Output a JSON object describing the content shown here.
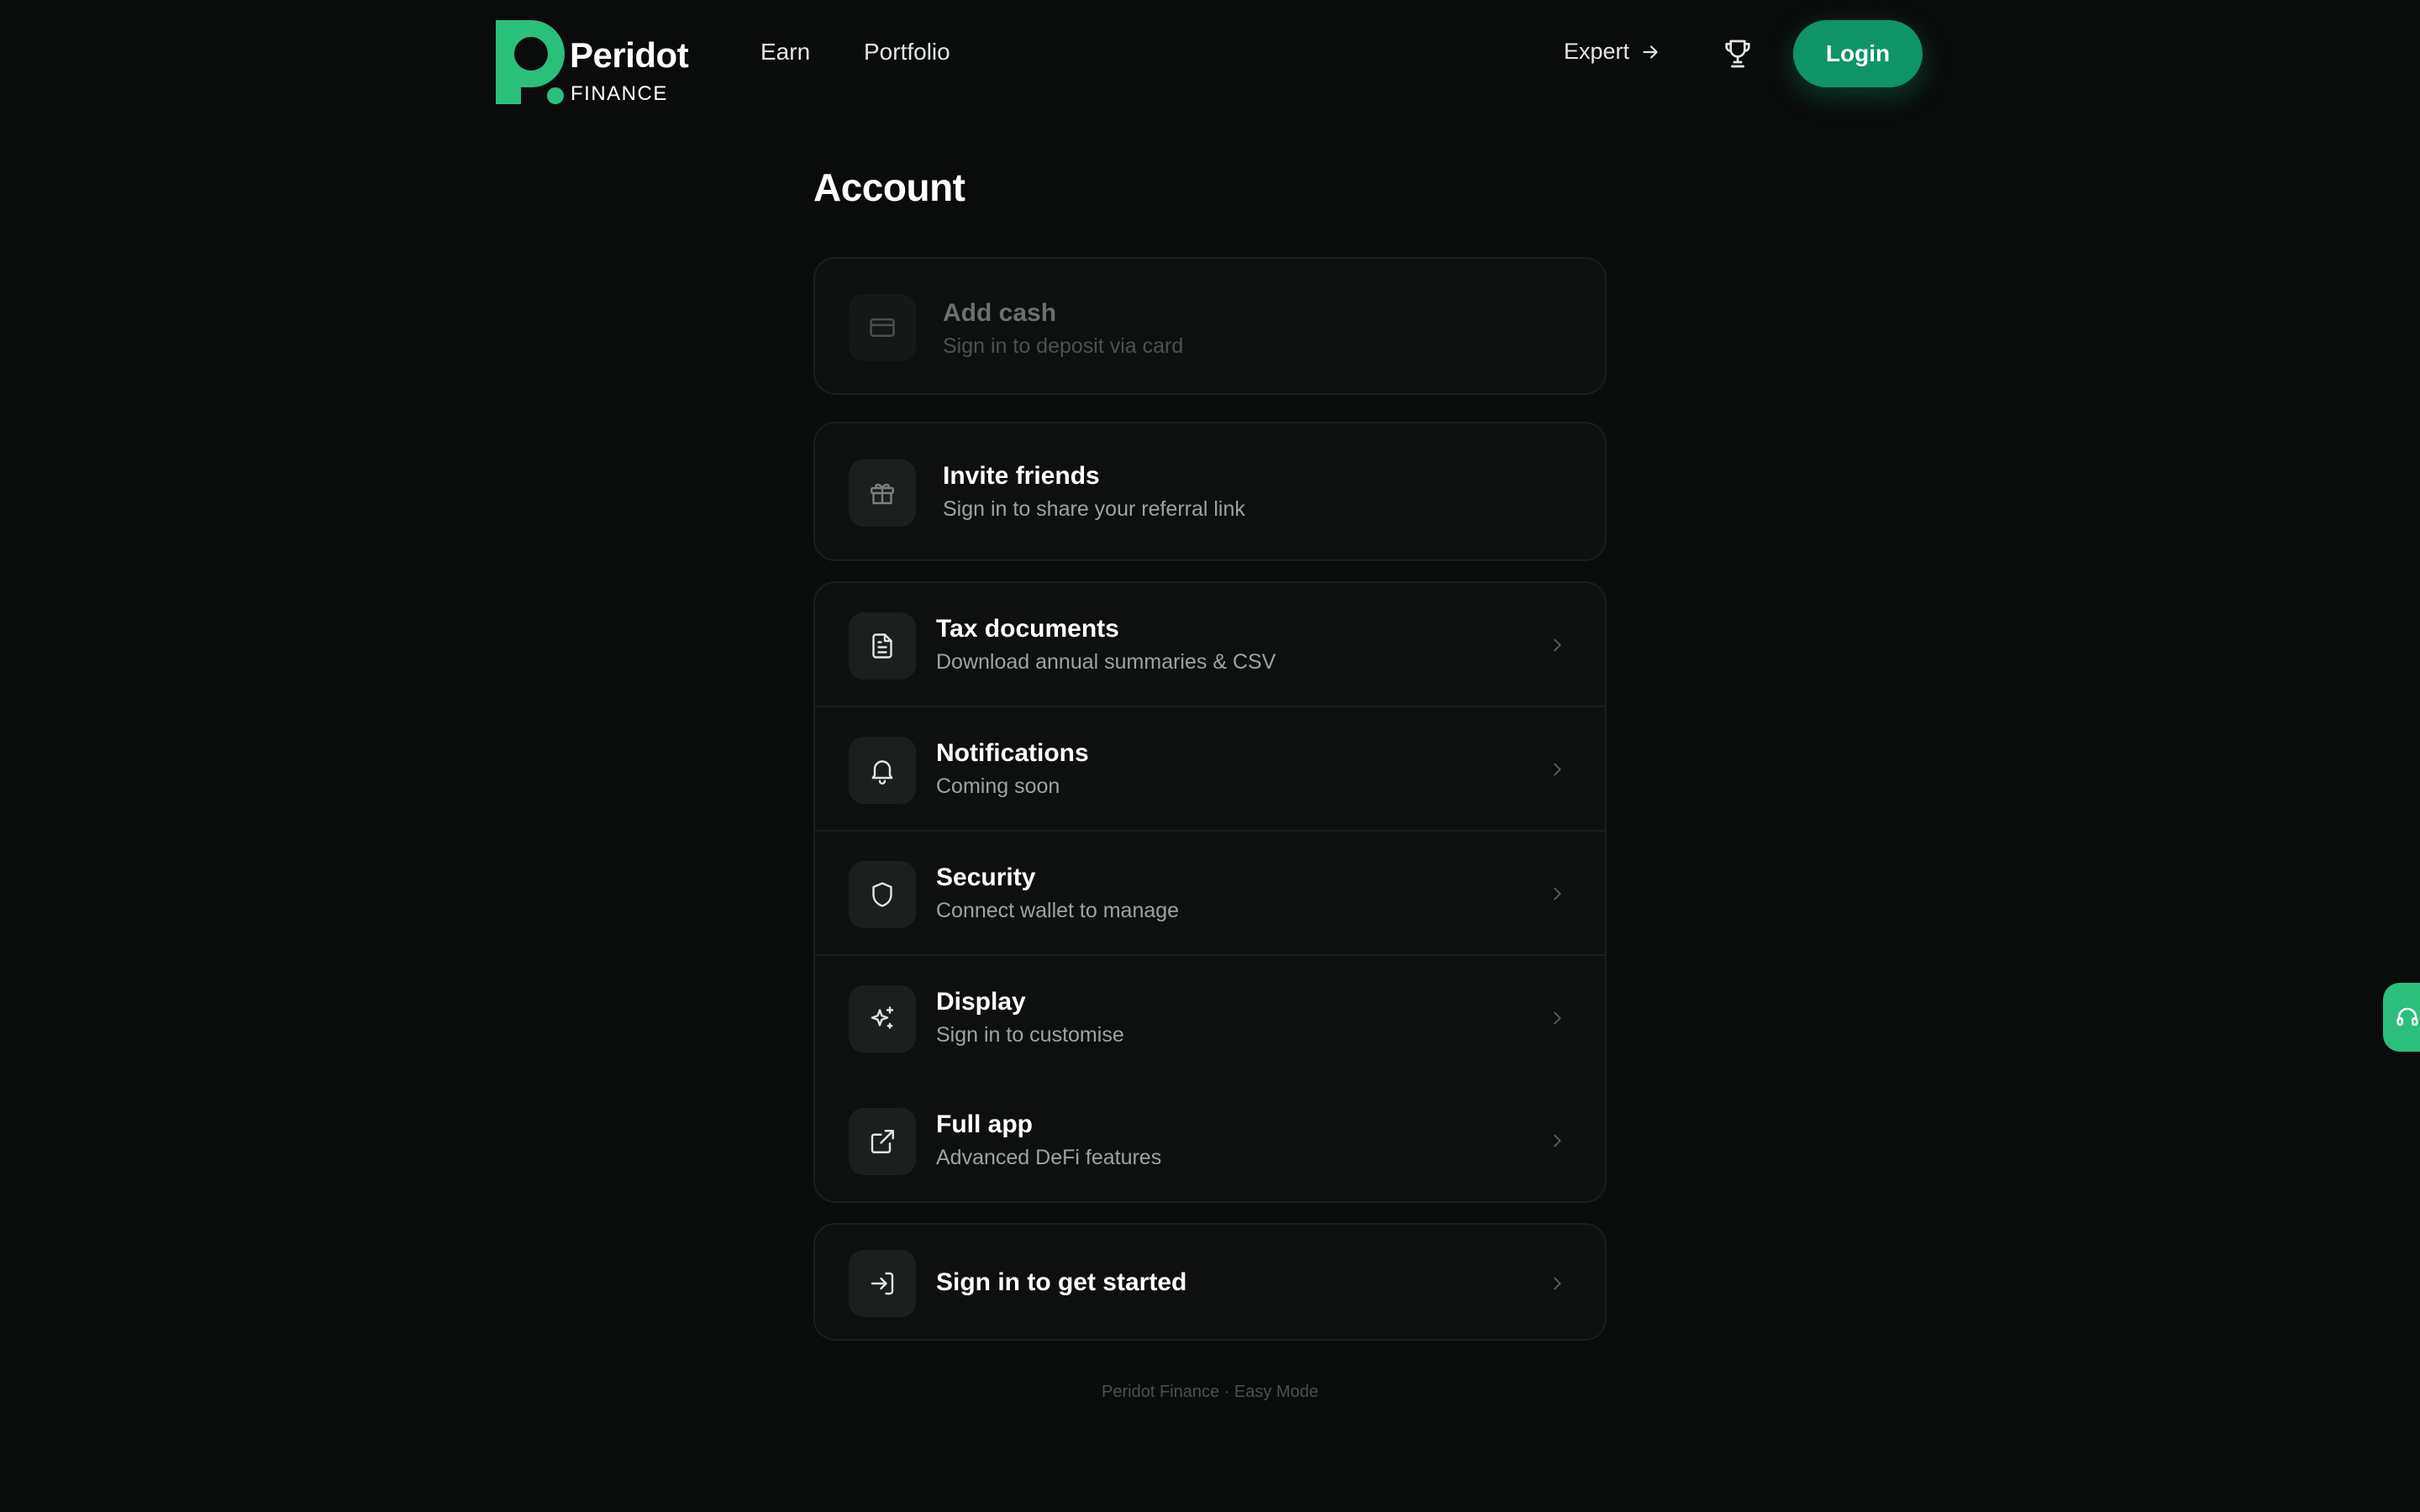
{
  "brand": {
    "name": "Peridot",
    "sub": "FINANCE",
    "accent": "#2bbf7c",
    "button_color": "#0e9466"
  },
  "nav": {
    "earn": "Earn",
    "portfolio": "Portfolio",
    "expert": "Expert",
    "login": "Login"
  },
  "page": {
    "title": "Account"
  },
  "cards": {
    "add_cash": {
      "title": "Add cash",
      "subtitle": "Sign in to deposit via card",
      "icon": "credit-card-icon"
    },
    "invite": {
      "title": "Invite friends",
      "subtitle": "Sign in to share your referral link",
      "icon": "gift-icon"
    }
  },
  "settings": [
    {
      "title": "Tax documents",
      "subtitle": "Download annual summaries & CSV",
      "icon": "document-icon"
    },
    {
      "title": "Notifications",
      "subtitle": "Coming soon",
      "icon": "bell-icon"
    },
    {
      "title": "Security",
      "subtitle": "Connect wallet to manage",
      "icon": "shield-icon"
    },
    {
      "title": "Display",
      "subtitle": "Sign in to customise",
      "icon": "sparkle-icon"
    },
    {
      "title": "Full app",
      "subtitle": "Advanced DeFi features",
      "icon": "external-link-icon"
    }
  ],
  "signin": {
    "title": "Sign in to get started",
    "icon": "sign-in-icon"
  },
  "footer": {
    "text": "Peridot Finance · Easy Mode"
  }
}
